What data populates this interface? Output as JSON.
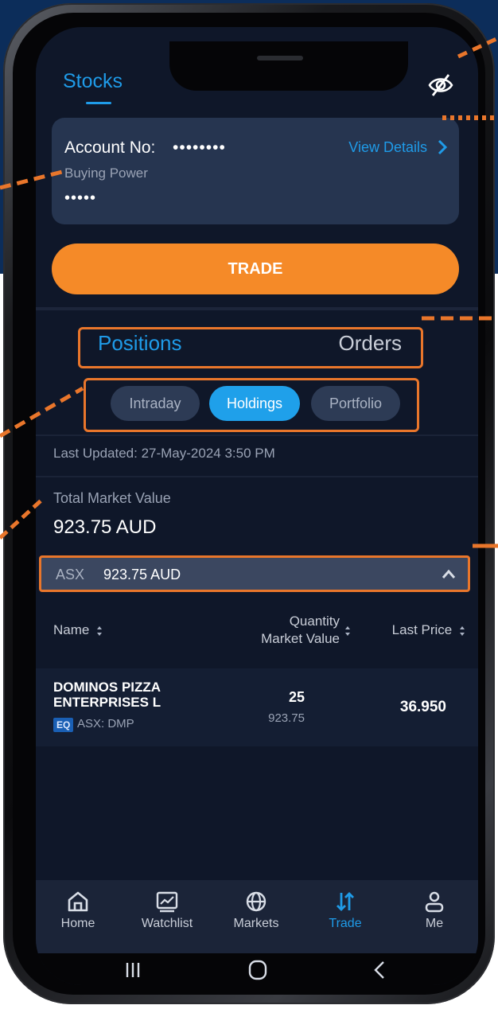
{
  "header": {
    "title": "Stocks"
  },
  "account": {
    "account_label": "Account No:",
    "account_mask": "••••••••",
    "view_details": "View Details",
    "buying_power_label": "Buying Power",
    "buying_power_mask": "•••••"
  },
  "trade_button": "TRADE",
  "tabs": {
    "positions": "Positions",
    "orders": "Orders"
  },
  "sub_tabs": {
    "intraday": "Intraday",
    "holdings": "Holdings",
    "portfolio": "Portfolio"
  },
  "last_updated": "Last Updated: 27-May-2024 3:50 PM",
  "total_market_value": {
    "label": "Total Market Value",
    "value": "923.75 AUD"
  },
  "exchange": {
    "name": "ASX",
    "value": "923.75 AUD"
  },
  "columns": {
    "name": "Name",
    "quantity": "Quantity",
    "market_value": "Market Value",
    "last_price": "Last Price"
  },
  "holdings": [
    {
      "name_line1": "DOMINOS PIZZA",
      "name_line2": "ENTERPRISES L",
      "badge": "EQ",
      "code": "ASX: DMP",
      "quantity": "25",
      "market_value": "923.75",
      "last_price": "36.950"
    }
  ],
  "bottom_nav": [
    {
      "label": "Home",
      "icon": "home-icon"
    },
    {
      "label": "Watchlist",
      "icon": "watchlist-chart-icon"
    },
    {
      "label": "Markets",
      "icon": "globe-icon"
    },
    {
      "label": "Trade",
      "icon": "trade-arrows-icon"
    },
    {
      "label": "Me",
      "icon": "person-icon"
    }
  ],
  "colors": {
    "accent": "#1f9be8",
    "trade_orange": "#f58a28",
    "highlight_outline": "#e9762b",
    "screen_bg": "#0f1729",
    "header_bg": "#0c2d5a"
  }
}
